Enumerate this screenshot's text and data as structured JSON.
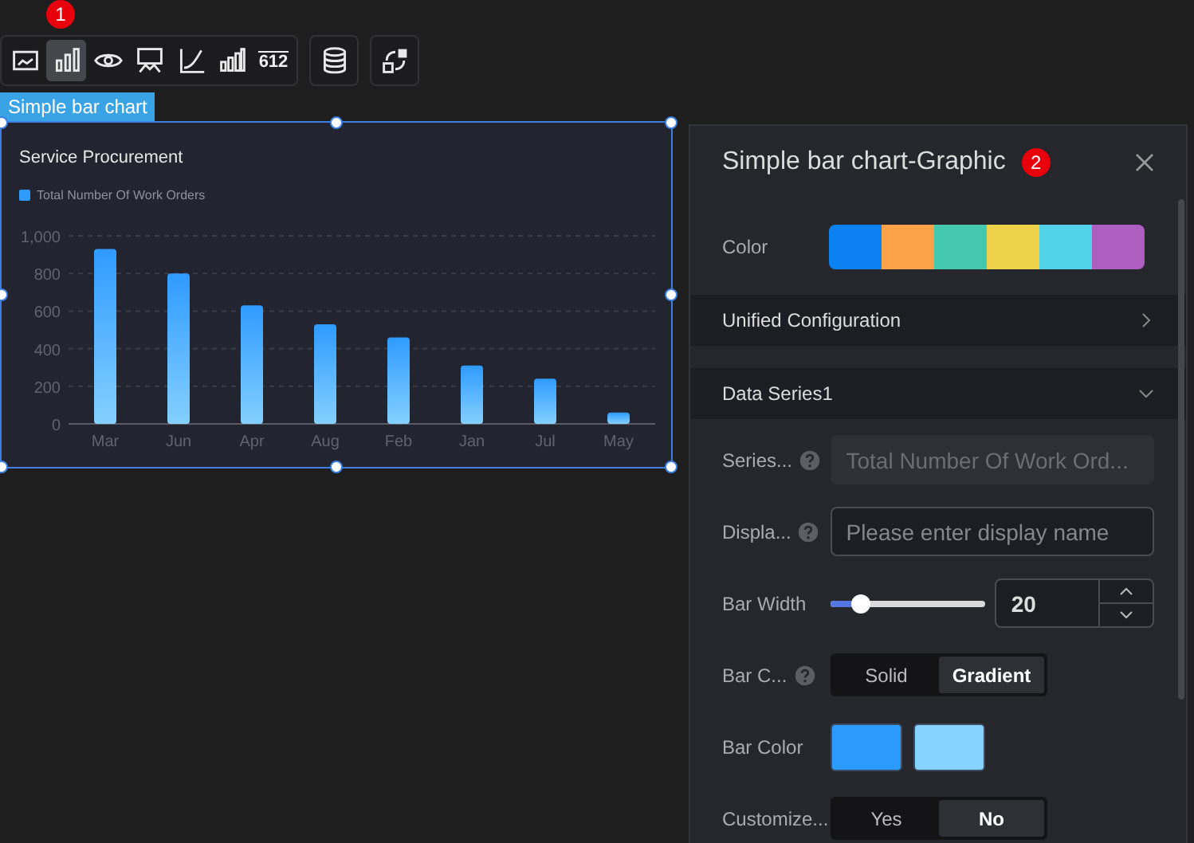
{
  "toolbar": {
    "badge": "1",
    "groups": [
      {
        "items": [
          {
            "kind": "image",
            "selected": false
          },
          {
            "kind": "bars",
            "selected": true
          },
          {
            "kind": "eye",
            "selected": false
          },
          {
            "kind": "board",
            "selected": false
          },
          {
            "kind": "line",
            "selected": false
          },
          {
            "kind": "columns",
            "selected": false
          },
          {
            "kind": "digits",
            "text": "612",
            "selected": false
          }
        ]
      },
      {
        "items": [
          {
            "kind": "database",
            "selected": false
          }
        ]
      },
      {
        "items": [
          {
            "kind": "swap",
            "selected": false
          }
        ]
      }
    ]
  },
  "widget": {
    "label": "Simple bar chart",
    "title": "Service Procurement",
    "chart_data": {
      "type": "bar",
      "categories": [
        "Mar",
        "Jun",
        "Apr",
        "Aug",
        "Feb",
        "Jan",
        "Jul",
        "May"
      ],
      "series": [
        {
          "name": "Total Number Of Work Orders",
          "color": "#2f9bff",
          "values": [
            930,
            800,
            630,
            530,
            460,
            310,
            240,
            60
          ]
        }
      ],
      "grid": true,
      "ylim": [
        0,
        1000
      ],
      "yticks": [
        0,
        200,
        400,
        600,
        800,
        {
          "value": 1000,
          "label": "1,000"
        }
      ]
    }
  },
  "panel": {
    "title": "Simple bar chart-Graphic",
    "badge": "2",
    "color_label": "Color",
    "palette": [
      {
        "color": "#0c82f2"
      },
      {
        "color": "#fca34a"
      },
      {
        "color": "#44c8b0"
      },
      {
        "color": "#edd24a"
      },
      {
        "color": "#52d2e8"
      },
      {
        "color": "#ad5fc0"
      }
    ],
    "sections": [
      {
        "title": "Unified Configuration",
        "expanded": false
      },
      {
        "title": "Data Series1",
        "expanded": true
      }
    ],
    "fields": [
      {
        "kind": "input",
        "label": "Series...",
        "help": true,
        "value": "Total Number Of Work Ord...",
        "disabled": true
      },
      {
        "kind": "input",
        "label": "Displa...",
        "help": true,
        "placeholder": "Please enter display name",
        "disabled": false
      },
      {
        "kind": "slider",
        "label": "Bar Width",
        "help": false,
        "level": 0.2,
        "value": "20"
      },
      {
        "kind": "segmented",
        "label": "Bar C...",
        "help": true,
        "options": [
          {
            "label": "Solid",
            "selected": false
          },
          {
            "label": "Gradient",
            "selected": true
          }
        ]
      },
      {
        "kind": "swatches",
        "label": "Bar Color",
        "help": false,
        "colors": [
          {
            "color": "#2b9bff"
          },
          {
            "color": "#86d3ff"
          }
        ]
      },
      {
        "kind": "segmented",
        "label": "Customize...",
        "help": false,
        "options": [
          {
            "label": "Yes",
            "selected": false
          },
          {
            "label": "No",
            "selected": true
          }
        ]
      }
    ]
  }
}
